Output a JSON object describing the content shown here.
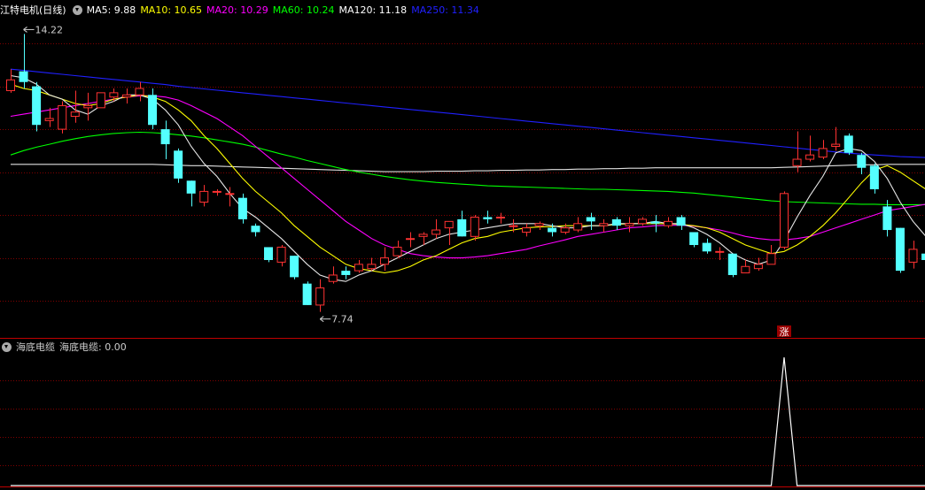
{
  "top_header": {
    "stock_name": "江特电机(日线)",
    "ma": [
      {
        "label": "MA5: 9.88",
        "color": "#ffffff"
      },
      {
        "label": "MA10: 10.65",
        "color": "#ffff00"
      },
      {
        "label": "MA20: 10.29",
        "color": "#ff00ff"
      },
      {
        "label": "MA60: 10.24",
        "color": "#00ff00"
      },
      {
        "label": "MA120: 11.18",
        "color": "#ffffff"
      },
      {
        "label": "MA250: 11.34",
        "color": "#0000ff"
      }
    ]
  },
  "bottom_header": {
    "indicator": "海底电缆",
    "value_label": "海底电缆: 0.00"
  },
  "annotations": {
    "high": "14.22",
    "low": "7.74",
    "signal": "涨"
  },
  "colors": {
    "up": "#ff3232",
    "down": "#54ffff",
    "ma5": "#e6e6e6",
    "ma10": "#ffff00",
    "ma20": "#ff00ff",
    "ma60": "#00ff00",
    "ma120": "#e0e0e0",
    "ma250": "#2020ff",
    "grid": "#800000",
    "divider": "#c00000"
  },
  "chart_data": {
    "type": "candlestick",
    "y_range": [
      7.3,
      14.6
    ],
    "bars": [
      [
        12.9,
        13.15,
        13.4,
        12.85
      ],
      [
        13.35,
        13.1,
        14.22,
        12.95
      ],
      [
        13.0,
        12.1,
        13.1,
        11.95
      ],
      [
        12.2,
        12.25,
        12.5,
        12.05
      ],
      [
        12.0,
        12.55,
        12.65,
        11.9
      ],
      [
        12.3,
        12.4,
        12.9,
        12.15
      ],
      [
        12.5,
        12.55,
        12.85,
        12.2
      ],
      [
        12.5,
        12.85,
        13.6
      ],
      [
        12.75,
        12.85,
        12.95,
        12.65
      ],
      [
        12.75,
        12.8,
        12.95,
        12.6
      ],
      [
        12.8,
        12.95,
        13.1,
        12.65
      ],
      [
        12.8,
        12.1,
        12.95,
        12.0
      ],
      [
        12.0,
        11.65,
        12.2,
        11.3
      ],
      [
        11.5,
        10.85,
        11.55,
        10.75
      ],
      [
        10.8,
        10.5,
        10.8,
        10.2
      ],
      [
        10.3,
        10.55,
        10.7,
        10.2
      ],
      [
        10.55,
        10.55,
        10.6,
        10.45
      ],
      [
        10.5,
        10.5,
        10.65,
        10.2
      ],
      [
        10.4,
        9.9,
        10.5,
        9.8
      ],
      [
        9.75,
        9.6,
        9.8,
        9.5
      ],
      [
        9.25,
        8.95,
        9.25,
        8.9
      ],
      [
        8.9,
        9.25,
        9.3,
        8.8
      ],
      [
        9.05,
        8.55,
        9.05,
        8.5
      ],
      [
        8.4,
        7.9,
        8.45,
        7.9
      ],
      [
        7.9,
        8.3,
        8.5,
        7.74
      ],
      [
        8.45,
        8.6,
        8.8,
        8.4
      ],
      [
        8.7,
        8.6,
        8.8,
        8.5
      ],
      [
        8.7,
        8.85,
        8.95,
        8.65
      ],
      [
        8.75,
        8.85,
        9.0,
        8.7
      ],
      [
        8.85,
        9.0,
        9.25,
        8.7
      ],
      [
        9.05,
        9.25,
        9.4,
        9.0
      ],
      [
        9.45,
        9.45,
        9.6,
        9.25
      ],
      [
        9.5,
        9.55,
        9.6,
        9.3
      ],
      [
        9.55,
        9.65,
        9.9,
        9.45
      ],
      [
        9.7,
        9.85,
        9.85,
        9.3
      ],
      [
        9.9,
        9.5,
        10.1,
        9.5
      ],
      [
        9.5,
        9.95,
        10.0,
        9.4
      ],
      [
        9.95,
        9.9,
        10.1,
        9.8
      ],
      [
        9.95,
        9.95,
        10.05,
        9.8
      ],
      [
        9.75,
        9.75,
        9.9,
        9.6
      ],
      [
        9.6,
        9.7,
        9.8,
        9.5
      ],
      [
        9.75,
        9.8,
        9.85,
        9.65
      ],
      [
        9.7,
        9.6,
        9.8,
        9.5
      ],
      [
        9.6,
        9.7,
        9.8,
        9.55
      ],
      [
        9.65,
        9.8,
        9.95,
        9.6
      ],
      [
        9.95,
        9.85,
        10.05,
        9.65
      ],
      [
        9.75,
        9.8,
        9.9,
        9.6
      ],
      [
        9.9,
        9.75,
        9.95,
        9.65
      ],
      [
        9.75,
        9.8,
        9.95,
        9.6
      ],
      [
        9.8,
        9.9,
        9.95,
        9.75
      ],
      [
        9.85,
        9.8,
        10.0,
        9.6
      ],
      [
        9.75,
        9.85,
        9.95,
        9.7
      ],
      [
        9.95,
        9.75,
        10.0,
        9.65
      ],
      [
        9.6,
        9.3,
        9.6,
        9.25
      ],
      [
        9.35,
        9.15,
        9.45,
        9.1
      ],
      [
        9.15,
        9.15,
        9.25,
        8.95
      ],
      [
        9.1,
        8.6,
        9.1,
        8.55
      ],
      [
        8.65,
        8.8,
        8.95,
        8.65
      ],
      [
        8.75,
        8.85,
        9.0,
        8.7
      ],
      [
        8.85,
        9.1,
        9.3,
        8.85
      ],
      [
        9.25,
        10.5,
        10.55,
        9.2
      ],
      [
        11.15,
        11.3,
        11.95,
        11.0
      ],
      [
        11.3,
        11.4,
        11.85,
        11.25
      ],
      [
        11.35,
        11.55,
        11.75,
        11.3
      ],
      [
        11.6,
        11.65,
        12.05,
        11.5
      ],
      [
        11.85,
        11.45,
        11.9,
        11.4
      ],
      [
        11.4,
        11.1,
        11.45,
        10.95
      ],
      [
        11.15,
        10.6,
        11.2,
        10.5
      ],
      [
        10.2,
        9.65,
        10.35,
        9.5
      ],
      [
        9.7,
        8.7,
        9.7,
        8.65
      ],
      [
        8.9,
        9.2,
        9.4,
        8.75
      ],
      [
        9.1,
        8.95,
        9.4,
        8.9
      ]
    ],
    "ma5": [
      13.25,
      13.2,
      13.05,
      12.8,
      12.7,
      12.45,
      12.35,
      12.55,
      12.65,
      12.8,
      12.8,
      12.7,
      12.45,
      12.1,
      11.6,
      11.2,
      10.9,
      10.5,
      10.15,
      9.95,
      9.7,
      9.45,
      9.15,
      8.85,
      8.6,
      8.5,
      8.45,
      8.6,
      8.7,
      8.85,
      9.0,
      9.15,
      9.3,
      9.45,
      9.55,
      9.6,
      9.65,
      9.7,
      9.75,
      9.8,
      9.8,
      9.8,
      9.75,
      9.7,
      9.7,
      9.75,
      9.75,
      9.8,
      9.8,
      9.8,
      9.85,
      9.8,
      9.8,
      9.7,
      9.55,
      9.35,
      9.1,
      8.95,
      8.85,
      8.95,
      9.4,
      9.95,
      10.45,
      10.9,
      11.45,
      11.55,
      11.5,
      11.25,
      10.85,
      10.3,
      9.85,
      9.5
    ],
    "ma10": [
      13.05,
      12.95,
      12.9,
      12.8,
      12.7,
      12.6,
      12.55,
      12.6,
      12.7,
      12.75,
      12.8,
      12.75,
      12.65,
      12.45,
      12.2,
      11.85,
      11.55,
      11.2,
      10.85,
      10.55,
      10.3,
      10.05,
      9.75,
      9.5,
      9.25,
      9.05,
      8.85,
      8.75,
      8.7,
      8.65,
      8.7,
      8.8,
      8.95,
      9.05,
      9.2,
      9.35,
      9.45,
      9.5,
      9.6,
      9.65,
      9.7,
      9.72,
      9.73,
      9.75,
      9.75,
      9.75,
      9.75,
      9.78,
      9.8,
      9.8,
      9.8,
      9.8,
      9.78,
      9.75,
      9.7,
      9.6,
      9.45,
      9.3,
      9.2,
      9.1,
      9.15,
      9.3,
      9.5,
      9.75,
      10.05,
      10.4,
      10.75,
      11.05,
      11.15,
      11.0,
      10.8,
      10.6
    ],
    "ma20": [
      12.3,
      12.35,
      12.4,
      12.45,
      12.5,
      12.55,
      12.6,
      12.65,
      12.7,
      12.75,
      12.78,
      12.78,
      12.75,
      12.68,
      12.55,
      12.4,
      12.25,
      12.05,
      11.85,
      11.6,
      11.35,
      11.1,
      10.85,
      10.6,
      10.35,
      10.1,
      9.85,
      9.65,
      9.45,
      9.3,
      9.2,
      9.1,
      9.05,
      9.02,
      9.0,
      9.0,
      9.02,
      9.05,
      9.1,
      9.15,
      9.2,
      9.28,
      9.35,
      9.42,
      9.5,
      9.55,
      9.6,
      9.65,
      9.7,
      9.72,
      9.75,
      9.76,
      9.76,
      9.74,
      9.7,
      9.65,
      9.58,
      9.5,
      9.45,
      9.42,
      9.42,
      9.45,
      9.5,
      9.6,
      9.7,
      9.8,
      9.9,
      10.0,
      10.1,
      10.15,
      10.2,
      10.25
    ],
    "ma60": [
      11.4,
      11.5,
      11.58,
      11.65,
      11.72,
      11.78,
      11.83,
      11.87,
      11.9,
      11.92,
      11.93,
      11.92,
      11.9,
      11.87,
      11.84,
      11.8,
      11.75,
      11.7,
      11.65,
      11.58,
      11.5,
      11.42,
      11.35,
      11.27,
      11.2,
      11.13,
      11.06,
      11.0,
      10.95,
      10.9,
      10.86,
      10.82,
      10.79,
      10.76,
      10.74,
      10.72,
      10.7,
      10.68,
      10.67,
      10.66,
      10.65,
      10.64,
      10.63,
      10.62,
      10.61,
      10.6,
      10.6,
      10.59,
      10.58,
      10.57,
      10.56,
      10.55,
      10.53,
      10.51,
      10.48,
      10.45,
      10.42,
      10.39,
      10.36,
      10.33,
      10.31,
      10.3,
      10.29,
      10.28,
      10.27,
      10.26,
      10.25,
      10.25,
      10.24,
      10.24,
      10.24,
      10.24
    ],
    "ma120": [
      11.18,
      11.18,
      11.18,
      11.18,
      11.18,
      11.18,
      11.18,
      11.18,
      11.18,
      11.18,
      11.18,
      11.18,
      11.17,
      11.16,
      11.15,
      11.15,
      11.14,
      11.13,
      11.12,
      11.11,
      11.1,
      11.09,
      11.08,
      11.07,
      11.06,
      11.05,
      11.04,
      11.03,
      11.02,
      11.01,
      11.01,
      11.01,
      11.01,
      11.02,
      11.02,
      11.02,
      11.03,
      11.03,
      11.04,
      11.04,
      11.05,
      11.05,
      11.06,
      11.06,
      11.07,
      11.07,
      11.08,
      11.08,
      11.09,
      11.09,
      11.1,
      11.1,
      11.1,
      11.1,
      11.1,
      11.1,
      11.1,
      11.1,
      11.1,
      11.1,
      11.11,
      11.12,
      11.13,
      11.14,
      11.15,
      11.16,
      11.17,
      11.17,
      11.18,
      11.18,
      11.18,
      11.18
    ],
    "ma250": [
      13.4,
      13.37,
      13.34,
      13.31,
      13.28,
      13.25,
      13.22,
      13.19,
      13.16,
      13.13,
      13.1,
      13.07,
      13.04,
      13.0,
      12.97,
      12.94,
      12.91,
      12.88,
      12.85,
      12.82,
      12.79,
      12.76,
      12.73,
      12.7,
      12.67,
      12.64,
      12.61,
      12.58,
      12.55,
      12.52,
      12.49,
      12.46,
      12.43,
      12.4,
      12.37,
      12.34,
      12.31,
      12.28,
      12.25,
      12.22,
      12.19,
      12.16,
      12.13,
      12.1,
      12.07,
      12.04,
      12.01,
      11.98,
      11.95,
      11.92,
      11.89,
      11.86,
      11.83,
      11.8,
      11.77,
      11.74,
      11.71,
      11.68,
      11.65,
      11.62,
      11.59,
      11.56,
      11.53,
      11.5,
      11.47,
      11.44,
      11.42,
      11.4,
      11.38,
      11.36,
      11.35,
      11.34
    ],
    "indicator": {
      "name": "海底电缆",
      "y_range": [
        0,
        1
      ],
      "values": [
        0,
        0,
        0,
        0,
        0,
        0,
        0,
        0,
        0,
        0,
        0,
        0,
        0,
        0,
        0,
        0,
        0,
        0,
        0,
        0,
        0,
        0,
        0,
        0,
        0,
        0,
        0,
        0,
        0,
        0,
        0,
        0,
        0,
        0,
        0,
        0,
        0,
        0,
        0,
        0,
        0,
        0,
        0,
        0,
        0,
        0,
        0,
        0,
        0,
        0,
        0,
        0,
        0,
        0,
        0,
        0,
        0,
        0,
        0,
        0,
        1,
        0,
        0,
        0,
        0,
        0,
        0,
        0,
        0,
        0,
        0,
        0
      ]
    },
    "signal_index": 60,
    "high_index": 1,
    "low_index": 24
  }
}
